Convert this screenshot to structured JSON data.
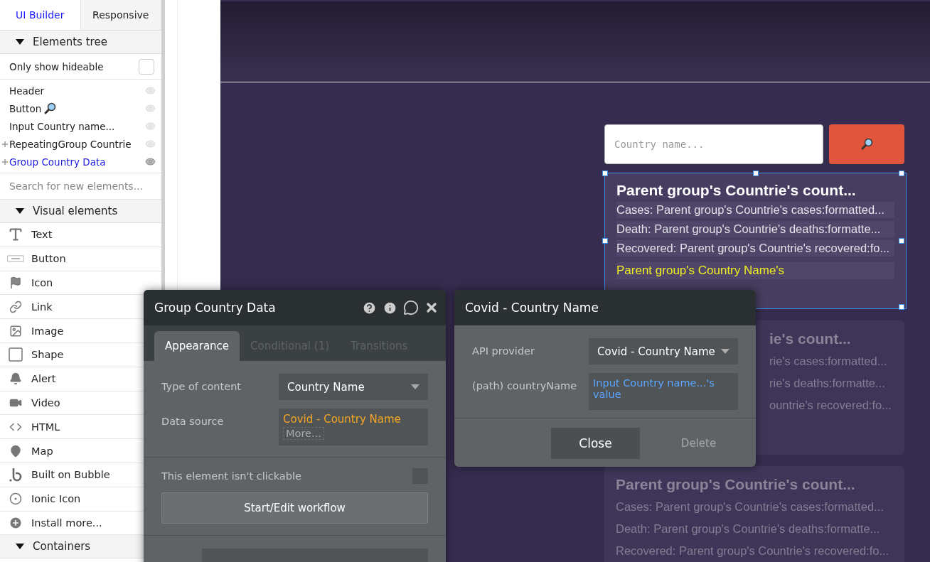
{
  "builder_tabs": [
    {
      "label": "UI Builder",
      "selected": true
    },
    {
      "label": "Responsive",
      "selected": false
    }
  ],
  "elements_tree": {
    "title": "Elements tree",
    "filter": {
      "label": "Only show hideable",
      "checked": false
    },
    "items": [
      {
        "label": "Header",
        "kind": "leaf",
        "selected": false
      },
      {
        "label": "Button",
        "kind": "leaf",
        "selected": false
      },
      {
        "label": "Input Country name...",
        "kind": "leaf",
        "selected": false
      },
      {
        "label": "RepeatingGroup Countrie",
        "kind": "group",
        "selected": false
      },
      {
        "label": "Group Country Data",
        "kind": "group",
        "selected": true
      }
    ]
  },
  "element_search": {
    "placeholder": "Search for new elements..."
  },
  "visual_elements": {
    "title": "Visual elements",
    "items": [
      "Text",
      "Button",
      "Icon",
      "Link",
      "Image",
      "Shape",
      "Alert",
      "Video",
      "HTML",
      "Map",
      "Built on Bubble",
      "Ionic Icon",
      "Install more..."
    ]
  },
  "containers": {
    "title": "Containers"
  },
  "canvas": {
    "search_input": {
      "placeholder": "Country name..."
    },
    "selected_group": {
      "title": "Parent group's Countrie's count...",
      "lines": [
        "Cases: Parent group's Countrie's cases:formatted...",
        "Death: Parent group's Countrie's deaths:formatte...",
        "Recovered: Parent group's Countrie's recovered:fo..."
      ],
      "highlight": "Parent group's Country Name's"
    },
    "cards": [
      {
        "title": "ie's count...",
        "lines": [
          "rie's cases:formatted...",
          "rie's deaths:formatte...",
          "ountrie's recovered:fo..."
        ]
      },
      {
        "title": "Parent group's Countrie's count...",
        "lines": [
          "Cases: Parent group's Countrie's cases:formatted...",
          "Death: Parent group's Countrie's deaths:formatte...",
          "Recovered: Parent group's Countrie's recovered:fo..."
        ]
      }
    ]
  },
  "property_editor": {
    "title": "Group Country Data",
    "tabs": [
      {
        "label": "Appearance",
        "selected": true
      },
      {
        "label": "Conditional (1)",
        "selected": false
      },
      {
        "label": "Transitions",
        "selected": false
      }
    ],
    "type_of_content": {
      "label": "Type of content",
      "value": "Country Name"
    },
    "data_source": {
      "label": "Data source",
      "value": "Covid - Country Name",
      "more": "More..."
    },
    "clickable": {
      "label": "This element isn't clickable",
      "checked": false
    },
    "workflow_button": "Start/Edit workflow"
  },
  "api_dialog": {
    "title": "Covid - Country Name",
    "provider": {
      "label": "API provider",
      "value": "Covid - Country Name"
    },
    "path": {
      "label": "(path) countryName",
      "value": "Input Country name...'s value"
    },
    "buttons": [
      {
        "label": "Close",
        "disabled": false
      },
      {
        "label": "Delete",
        "disabled": true
      }
    ]
  }
}
